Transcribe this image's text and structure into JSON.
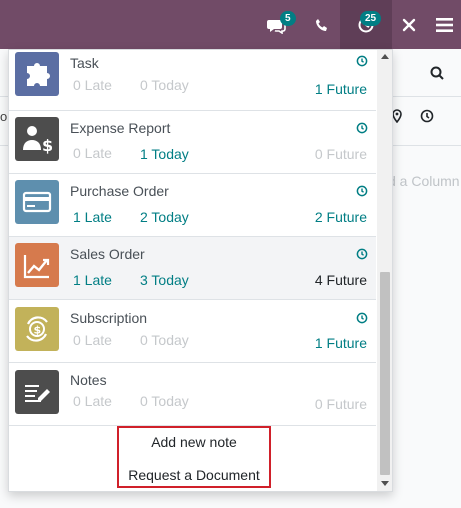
{
  "topbar": {
    "bg_color": "#714b67",
    "accent_color": "#017e84",
    "messages_badge": "5",
    "activities_badge": "25",
    "icons": [
      "chat-icon",
      "phone-icon",
      "activity-clock-icon",
      "debug-tools-icon",
      "menu-icon"
    ]
  },
  "background": {
    "add_column_text": "d a Column",
    "left_fragment": "o"
  },
  "activities": {
    "rows": [
      {
        "name": "Task",
        "icon": "puzzle-icon",
        "icon_color": "#5b6ea3",
        "late": "0 Late",
        "today": "0 Today",
        "future": "1 Future",
        "late_state": "muted",
        "today_state": "muted",
        "future_state": "teal"
      },
      {
        "name": "Expense Report",
        "icon": "expense-icon",
        "icon_color": "#4d4d4d",
        "late": "0 Late",
        "today": "1 Today",
        "future": "0 Future",
        "late_state": "muted",
        "today_state": "teal",
        "future_state": "muted"
      },
      {
        "name": "Purchase Order",
        "icon": "credit-card-icon",
        "icon_color": "#5e8fae",
        "late": "1 Late",
        "today": "2 Today",
        "future": "2 Future",
        "late_state": "teal",
        "today_state": "teal",
        "future_state": "teal"
      },
      {
        "name": "Sales Order",
        "icon": "trend-chart-icon",
        "icon_color": "#d67a4d",
        "late": "1 Late",
        "today": "3 Today",
        "future": "4 Future",
        "late_state": "teal",
        "today_state": "teal",
        "future_state": "dark"
      },
      {
        "name": "Subscription",
        "icon": "subscription-icon",
        "icon_color": "#c2b25a",
        "late": "0 Late",
        "today": "0 Today",
        "future": "1 Future",
        "late_state": "muted",
        "today_state": "muted",
        "future_state": "teal"
      },
      {
        "name": "Notes",
        "icon": "notes-icon",
        "icon_color": "#4d4d4d",
        "late": "0 Late",
        "today": "0 Today",
        "future": "0 Future",
        "late_state": "muted",
        "today_state": "muted",
        "future_state": "muted"
      }
    ],
    "actions": {
      "add_note": "Add new note",
      "request_document": "Request a Document"
    }
  }
}
